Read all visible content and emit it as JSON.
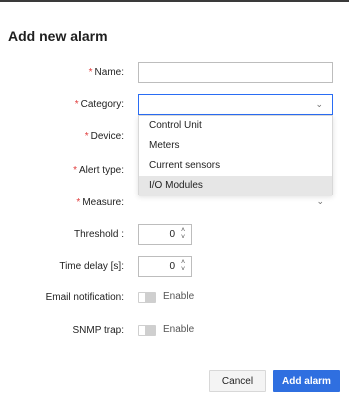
{
  "dialog": {
    "title": "Add new alarm"
  },
  "fields": {
    "name": {
      "label": "Name:",
      "required_mark": "*",
      "value": ""
    },
    "category": {
      "label": "Category:",
      "required_mark": "*",
      "value": ""
    },
    "device": {
      "label": "Device:",
      "required_mark": "*"
    },
    "alert_type": {
      "label": "Alert type:",
      "required_mark": "*"
    },
    "measure": {
      "label": "Measure:",
      "required_mark": "*"
    },
    "threshold": {
      "label": "Threshold :",
      "value": "0"
    },
    "time_delay": {
      "label": "Time delay [s]:",
      "value": "0"
    },
    "email_notification": {
      "label": "Email notification:",
      "toggle_label": "Enable",
      "enabled": false
    },
    "snmp_trap": {
      "label": "SNMP trap:",
      "toggle_label": "Enable",
      "enabled": false
    }
  },
  "category_dropdown": {
    "open": true,
    "options": [
      "Control Unit",
      "Meters",
      "Current sensors",
      "I/O Modules"
    ],
    "highlighted": "I/O Modules"
  },
  "buttons": {
    "cancel": "Cancel",
    "add": "Add alarm"
  },
  "icons": {
    "chevron": "chevron-down-icon",
    "spinner": "spinner-arrows-icon"
  },
  "colors": {
    "required": "#e03a3a",
    "accent": "#2f6fe0",
    "highlight": "#e6e6e6"
  }
}
